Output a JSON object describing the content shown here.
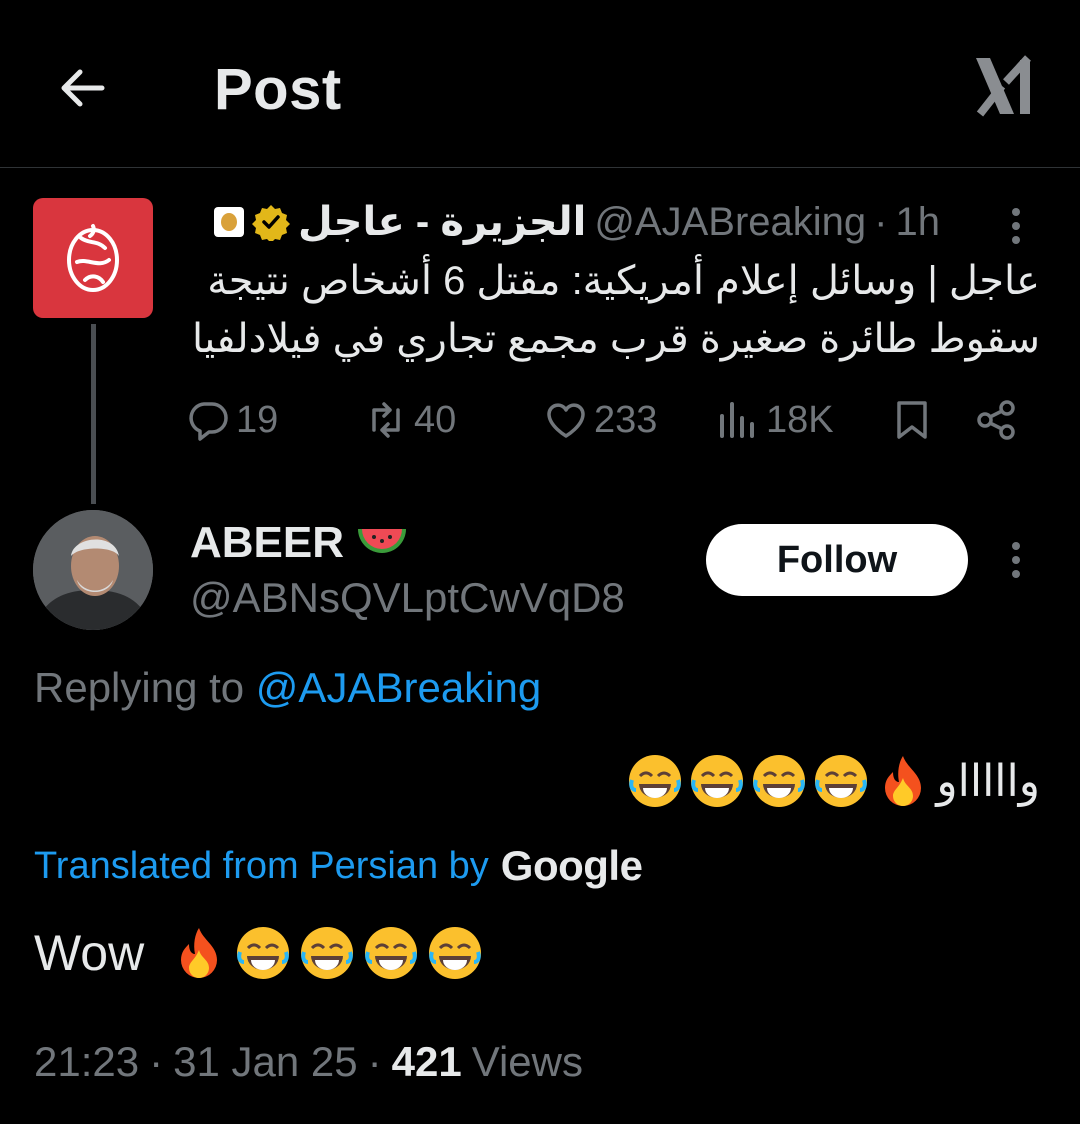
{
  "header": {
    "title": "Post",
    "back_icon": "arrow-left-icon",
    "brand_icon": "x-logo-icon"
  },
  "parent_post": {
    "display_name": "الجزيرة - عاجل",
    "handle": "@AJABreaking",
    "separator": "·",
    "time": "1h",
    "text": "عاجل | وسائل إعلام أمريكية: مقتل 6 أشخاص نتيجة سقوط طائرة صغيرة قرب مجمع تجاري في فيلادلفيا",
    "stats": {
      "replies": "19",
      "reposts": "40",
      "likes": "233",
      "views": "18K"
    }
  },
  "reply_post": {
    "display_name": "ABEER",
    "name_emoji": "watermelon-icon",
    "handle": "@ABNsQVLptCwVqD8",
    "follow_label": "Follow",
    "replying_prefix": "Replying to",
    "replying_to": "@AJABreaking",
    "original_text": "واااااو",
    "translated_prefix": "Translated from Persian by",
    "translator": "Google",
    "translated_text": "Wow",
    "timestamp": "21:23",
    "date": "31 Jan 25",
    "dot": "·",
    "views_count": "421",
    "views_label": "Views"
  },
  "colors": {
    "background": "#000000",
    "text": "#e7e9ea",
    "muted": "#71767b",
    "link": "#1d9bf0",
    "aja_red": "#d9363e",
    "verified_gold": "#e2b719"
  }
}
